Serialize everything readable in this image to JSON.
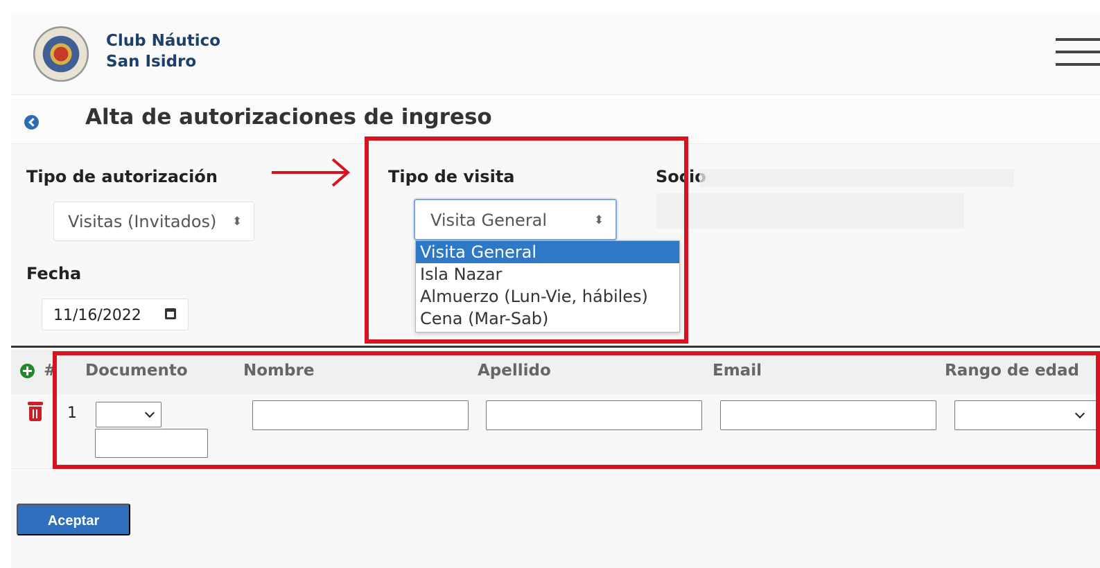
{
  "brand": {
    "line1": "Club Náutico",
    "line2": "San Isidro"
  },
  "page": {
    "title": "Alta de autorizaciones de ingreso"
  },
  "form": {
    "authorization_type_label": "Tipo de autorización",
    "authorization_type_value": "Visitas (Invitados)",
    "visit_type_label": "Tipo de visita",
    "visit_type_value": "Visita General",
    "partner_label": "Socio",
    "date_label": "Fecha",
    "date_value": "11/16/2022"
  },
  "visit_options": [
    "Visita General",
    "Isla Nazar",
    "Almuerzo (Lun-Vie, hábiles)",
    "Cena (Mar-Sab)"
  ],
  "table": {
    "headers": [
      "#",
      "Documento",
      "Nombre",
      "Apellido",
      "Email",
      "Rango de edad"
    ],
    "row_number": "1"
  },
  "actions": {
    "accept": "Aceptar"
  },
  "icons": {
    "menu": "hamburger-menu-icon",
    "back": "back-chevron-icon",
    "add": "plus-circle-icon",
    "delete": "trash-icon",
    "calendar": "calendar-icon"
  },
  "colors": {
    "brand": "#1f3f6b",
    "primary": "#2f6fbd",
    "annotation": "#d6141f",
    "add": "#1f8a26",
    "delete": "#c92028"
  }
}
